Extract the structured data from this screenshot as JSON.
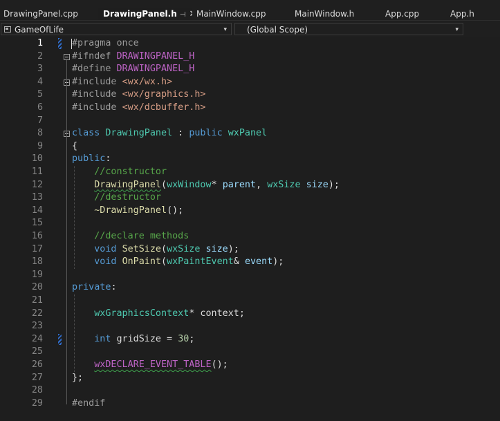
{
  "tabs": [
    {
      "label": "DrawingPanel.cpp",
      "active": false
    },
    {
      "label": "DrawingPanel.h",
      "active": true,
      "pin": "⊣",
      "close": "✕"
    },
    {
      "label": "MainWindow.cpp",
      "active": false
    },
    {
      "label": "MainWindow.h",
      "active": false
    },
    {
      "label": "App.cpp",
      "active": false
    },
    {
      "label": "App.h",
      "active": false
    }
  ],
  "nav": {
    "project": "GameOfLife",
    "scope": "(Global Scope)",
    "arrow": "▾"
  },
  "lines": [
    {
      "n": "1",
      "tokens": [
        [
          "pp",
          "#pragma once"
        ]
      ]
    },
    {
      "n": "2",
      "tokens": [
        [
          "pp",
          "#ifndef "
        ],
        [
          "mc",
          "DRAWINGPANEL_H"
        ]
      ]
    },
    {
      "n": "3",
      "tokens": [
        [
          "pp",
          "#define "
        ],
        [
          "mc",
          "DRAWINGPANEL_H"
        ]
      ]
    },
    {
      "n": "4",
      "tokens": [
        [
          "pp",
          "#include "
        ],
        [
          "st",
          "<wx/wx.h>"
        ]
      ]
    },
    {
      "n": "5",
      "tokens": [
        [
          "pp",
          "#include "
        ],
        [
          "st",
          "<wx/graphics.h>"
        ]
      ]
    },
    {
      "n": "6",
      "tokens": [
        [
          "pp",
          "#include "
        ],
        [
          "st",
          "<wx/dcbuffer.h>"
        ]
      ]
    },
    {
      "n": "7",
      "tokens": []
    },
    {
      "n": "8",
      "tokens": [
        [
          "k",
          "class "
        ],
        [
          "ty",
          "DrawingPanel"
        ],
        [
          "id",
          " : "
        ],
        [
          "k",
          "public "
        ],
        [
          "ty",
          "wxPanel"
        ]
      ]
    },
    {
      "n": "9",
      "tokens": [
        [
          "id",
          "{"
        ]
      ]
    },
    {
      "n": "10",
      "tokens": [
        [
          "k",
          "public"
        ],
        [
          "id",
          ":"
        ]
      ]
    },
    {
      "n": "11",
      "tokens": [
        [
          "id",
          "    "
        ],
        [
          "cm",
          "//constructor"
        ]
      ]
    },
    {
      "n": "12",
      "tokens": [
        [
          "id",
          "    "
        ],
        [
          "fn sq",
          "DrawingPanel"
        ],
        [
          "id",
          "("
        ],
        [
          "ty",
          "wxWindow"
        ],
        [
          "id",
          "* "
        ],
        [
          "pa",
          "parent"
        ],
        [
          "id",
          ", "
        ],
        [
          "ty",
          "wxSize"
        ],
        [
          "id",
          " "
        ],
        [
          "pa",
          "size"
        ],
        [
          "id",
          ");"
        ]
      ]
    },
    {
      "n": "13",
      "tokens": [
        [
          "id",
          "    "
        ],
        [
          "cm",
          "//destructor"
        ]
      ]
    },
    {
      "n": "14",
      "tokens": [
        [
          "id",
          "    "
        ],
        [
          "fn",
          "~DrawingPanel"
        ],
        [
          "id",
          "();"
        ]
      ]
    },
    {
      "n": "15",
      "tokens": []
    },
    {
      "n": "16",
      "tokens": [
        [
          "id",
          "    "
        ],
        [
          "cm",
          "//declare methods"
        ]
      ]
    },
    {
      "n": "17",
      "tokens": [
        [
          "id",
          "    "
        ],
        [
          "k",
          "void "
        ],
        [
          "fn",
          "SetSize"
        ],
        [
          "id",
          "("
        ],
        [
          "ty",
          "wxSize"
        ],
        [
          "id",
          " "
        ],
        [
          "pa",
          "size"
        ],
        [
          "id",
          ");"
        ]
      ]
    },
    {
      "n": "18",
      "tokens": [
        [
          "id",
          "    "
        ],
        [
          "k",
          "void "
        ],
        [
          "fn",
          "OnPaint"
        ],
        [
          "id",
          "("
        ],
        [
          "ty",
          "wxPaintEvent"
        ],
        [
          "id",
          "& "
        ],
        [
          "pa",
          "event"
        ],
        [
          "id",
          ");"
        ]
      ]
    },
    {
      "n": "19",
      "tokens": []
    },
    {
      "n": "20",
      "tokens": [
        [
          "k",
          "private"
        ],
        [
          "id",
          ":"
        ]
      ]
    },
    {
      "n": "21",
      "tokens": []
    },
    {
      "n": "22",
      "tokens": [
        [
          "id",
          "    "
        ],
        [
          "ty",
          "wxGraphicsContext"
        ],
        [
          "id",
          "* context;"
        ]
      ]
    },
    {
      "n": "23",
      "tokens": []
    },
    {
      "n": "24",
      "tokens": [
        [
          "id",
          "    "
        ],
        [
          "k",
          "int "
        ],
        [
          "id",
          "gridSize = "
        ],
        [
          "nu",
          "30"
        ],
        [
          "id",
          ";"
        ]
      ]
    },
    {
      "n": "25",
      "tokens": []
    },
    {
      "n": "26",
      "tokens": [
        [
          "id",
          "    "
        ],
        [
          "mc sq",
          "wxDECLARE_EVENT_TABLE"
        ],
        [
          "id",
          "();"
        ]
      ]
    },
    {
      "n": "27",
      "tokens": [
        [
          "id",
          "};"
        ]
      ]
    },
    {
      "n": "28",
      "tokens": []
    },
    {
      "n": "29",
      "tokens": [
        [
          "pp",
          "#endif"
        ]
      ]
    }
  ]
}
